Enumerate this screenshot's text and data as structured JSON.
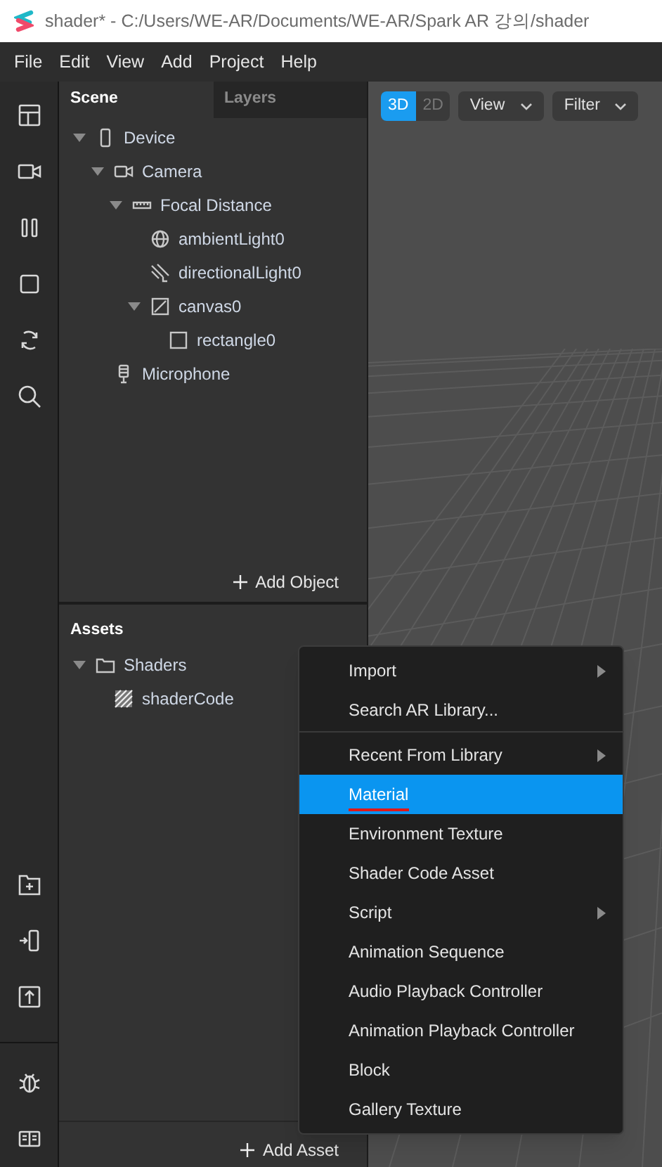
{
  "window": {
    "title": "shader* - C:/Users/WE-AR/Documents/WE-AR/Spark AR 강의/shader"
  },
  "menu_bar": [
    "File",
    "Edit",
    "View",
    "Add",
    "Project",
    "Help"
  ],
  "panel_tabs": [
    {
      "label": "Scene",
      "selected": true
    },
    {
      "label": "Layers",
      "selected": false
    }
  ],
  "scene_tree": [
    {
      "label": "Device",
      "kind": "device",
      "expanded": true,
      "children": [
        {
          "label": "Camera",
          "kind": "camera",
          "expanded": true,
          "children": [
            {
              "label": "Focal Distance",
              "kind": "ruler",
              "expanded": true,
              "children": [
                {
                  "label": "ambientLight0",
                  "kind": "globe"
                },
                {
                  "label": "directionalLight0",
                  "kind": "light"
                },
                {
                  "label": "canvas0",
                  "kind": "canvas",
                  "expanded": true,
                  "children": [
                    {
                      "label": "rectangle0",
                      "kind": "rect"
                    }
                  ]
                }
              ]
            }
          ]
        },
        {
          "label": "Microphone",
          "kind": "mic"
        }
      ]
    }
  ],
  "add_object": "Add Object",
  "assets": {
    "title": "Assets",
    "tree": [
      {
        "label": "Shaders",
        "kind": "folder",
        "expanded": true,
        "children": [
          {
            "label": "shaderCode",
            "kind": "shader"
          }
        ]
      }
    ],
    "add_asset": "Add Asset"
  },
  "viewport": {
    "mode_toggle": [
      {
        "label": "3D",
        "selected": true
      },
      {
        "label": "2D",
        "selected": false
      }
    ],
    "dropdowns": [
      "View",
      "Filter"
    ]
  },
  "context_menu": [
    [
      {
        "label": "Import",
        "submenu": true,
        "selected": false,
        "underlined": false
      },
      {
        "label": "Search AR Library...",
        "submenu": false,
        "selected": false,
        "underlined": false
      }
    ],
    [
      {
        "label": "Recent From Library",
        "submenu": true,
        "selected": false,
        "underlined": false
      },
      {
        "label": "Material",
        "submenu": false,
        "selected": true,
        "underlined": true
      },
      {
        "label": "Environment Texture",
        "submenu": false,
        "selected": false,
        "underlined": false
      },
      {
        "label": "Shader Code Asset",
        "submenu": false,
        "selected": false,
        "underlined": false
      },
      {
        "label": "Script",
        "submenu": true,
        "selected": false,
        "underlined": false
      },
      {
        "label": "Animation Sequence",
        "submenu": false,
        "selected": false,
        "underlined": false
      },
      {
        "label": "Audio Playback Controller",
        "submenu": false,
        "selected": false,
        "underlined": false
      },
      {
        "label": "Animation Playback Controller",
        "submenu": false,
        "selected": false,
        "underlined": false
      },
      {
        "label": "Block",
        "submenu": false,
        "selected": false,
        "underlined": false
      },
      {
        "label": "Gallery Texture",
        "submenu": false,
        "selected": false,
        "underlined": false
      }
    ]
  ]
}
